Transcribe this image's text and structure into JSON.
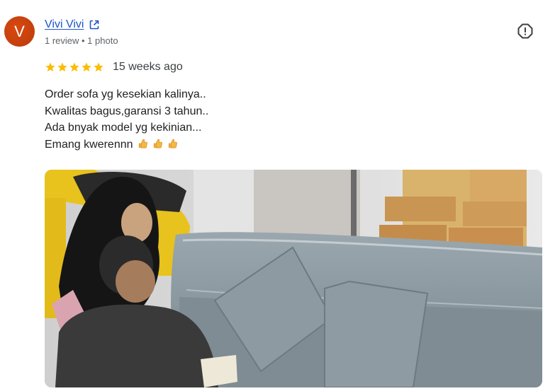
{
  "reviewer": {
    "initial": "V",
    "name": "Vivi Vivi",
    "meta": "1 review • 1 photo",
    "avatar_color": "#c2410c"
  },
  "rating": {
    "stars": 5,
    "max": 5,
    "star_color": "#fbbc04",
    "date": "15 weeks ago"
  },
  "review_text": {
    "line1": "Order sofa yg kesekian kalinya..",
    "line2": "Kwalitas bagus,garansi 3 tahun..",
    "line3": "Ada bnyak model yg kekinian...",
    "line4": "Emang kwerennn"
  },
  "icons": {
    "external_link": "open-in-new-icon",
    "report": "report-icon",
    "emoji": "thumbs-up-emoji"
  },
  "link_color": "#1a56c8"
}
